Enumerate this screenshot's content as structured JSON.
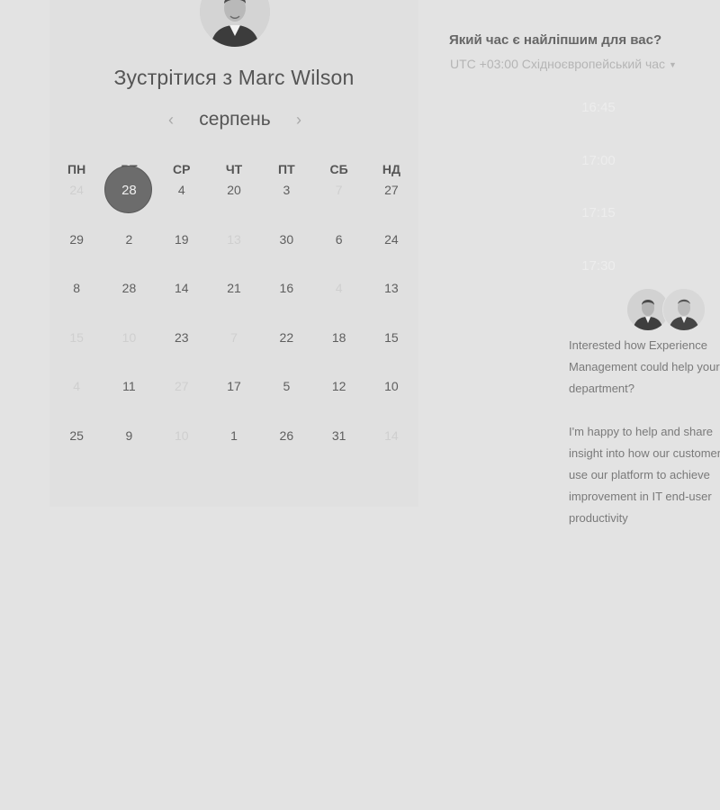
{
  "meeting": {
    "title": "Зустрітися з Marc Wilson",
    "month": "серпень",
    "prev_label": "‹",
    "next_label": "›",
    "avatar_icon": "person-avatar-icon"
  },
  "calendar": {
    "weekdays": [
      "ПН",
      "ВТ",
      "СР",
      "ЧТ",
      "ПТ",
      "СБ",
      "НД"
    ],
    "rows": [
      [
        {
          "d": "24",
          "faded": true
        },
        {
          "d": "28",
          "selected": true
        },
        {
          "d": "4"
        },
        {
          "d": "20"
        },
        {
          "d": "3"
        },
        {
          "d": "7",
          "faded": true
        },
        {
          "d": "27"
        }
      ],
      [
        {
          "d": "29"
        },
        {
          "d": "2"
        },
        {
          "d": "19"
        },
        {
          "d": "13",
          "faded": true
        },
        {
          "d": "30"
        },
        {
          "d": "6"
        },
        {
          "d": "24"
        }
      ],
      [
        {
          "d": "8"
        },
        {
          "d": "28"
        },
        {
          "d": "14"
        },
        {
          "d": "21"
        },
        {
          "d": "16"
        },
        {
          "d": "4",
          "faded": true
        },
        {
          "d": "13"
        }
      ],
      [
        {
          "d": "15",
          "faded": true
        },
        {
          "d": "10",
          "faded": true
        },
        {
          "d": "23"
        },
        {
          "d": "7",
          "faded": true
        },
        {
          "d": "22"
        },
        {
          "d": "18"
        },
        {
          "d": "15"
        }
      ],
      [
        {
          "d": "4",
          "faded": true
        },
        {
          "d": "11"
        },
        {
          "d": "27",
          "faded": true
        },
        {
          "d": "17"
        },
        {
          "d": "5"
        },
        {
          "d": "12"
        },
        {
          "d": "10"
        }
      ],
      [
        {
          "d": "25"
        },
        {
          "d": "9"
        },
        {
          "d": "10",
          "faded": true
        },
        {
          "d": "1"
        },
        {
          "d": "26"
        },
        {
          "d": "31"
        },
        {
          "d": "14",
          "faded": true
        }
      ]
    ]
  },
  "times": {
    "title": "Який час є найліпшим для вас?",
    "timezone": "UTC +03:00 Східноєвропейський час",
    "slots": [
      "16:45",
      "17:00",
      "17:15",
      "17:30"
    ]
  },
  "description": {
    "p1": "Interested how Experience Management could help your department?",
    "p2": "I'm happy to help and share insight into how our customers use our platform to achieve improvement in IT end-user productivity"
  },
  "colors": {
    "background": "#e3e3e3",
    "selected_day": "#6c6c6c"
  }
}
